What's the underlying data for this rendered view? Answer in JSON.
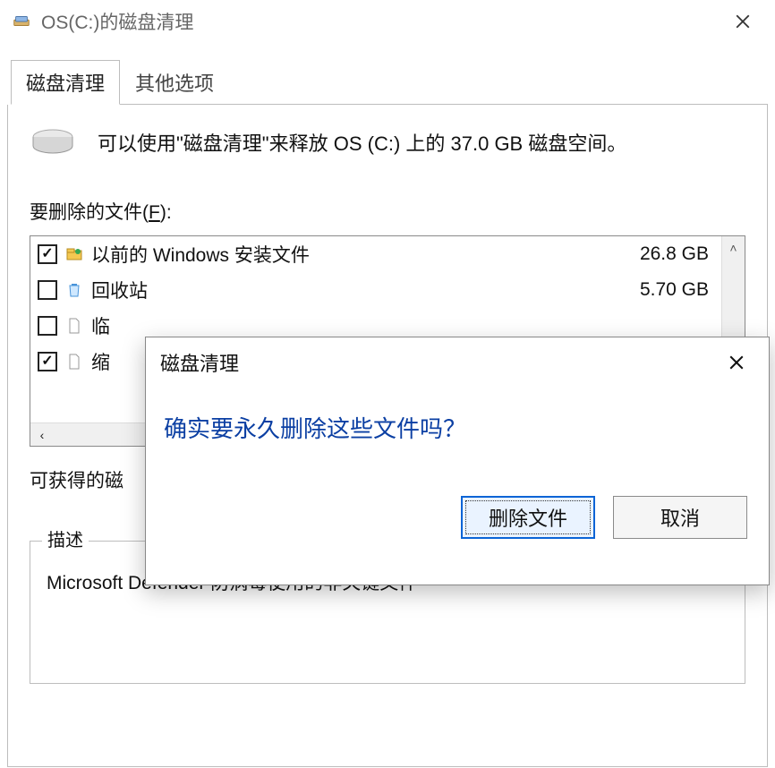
{
  "window": {
    "title": "OS(C:)的磁盘清理"
  },
  "tabs": [
    {
      "label": "磁盘清理",
      "active": true
    },
    {
      "label": "其他选项",
      "active": false
    }
  ],
  "summary": "可以使用\"磁盘清理\"来释放 OS (C:) 上的 37.0 GB 磁盘空间。",
  "files_section_label_pre": "要删除的文件(",
  "files_section_hotkey": "F",
  "files_section_label_post": "):",
  "files": [
    {
      "checked": true,
      "icon": "windows-folder-icon",
      "name": "以前的 Windows 安装文件",
      "size": "26.8 GB"
    },
    {
      "checked": false,
      "icon": "recycle-bin-icon",
      "name": "回收站",
      "size": "5.70 GB"
    },
    {
      "checked": false,
      "icon": "file-icon",
      "name": "临",
      "size": ""
    },
    {
      "checked": true,
      "icon": "file-icon",
      "name": "缩",
      "size": ""
    }
  ],
  "gain_label_partial": "可获得的磁",
  "description": {
    "legend": "描述",
    "text": "Microsoft Defender 防病毒使用的非关键文件"
  },
  "modal": {
    "title": "磁盘清理",
    "message": "确实要永久删除这些文件吗？",
    "buttons": {
      "confirm": "删除文件",
      "cancel": "取消"
    }
  }
}
